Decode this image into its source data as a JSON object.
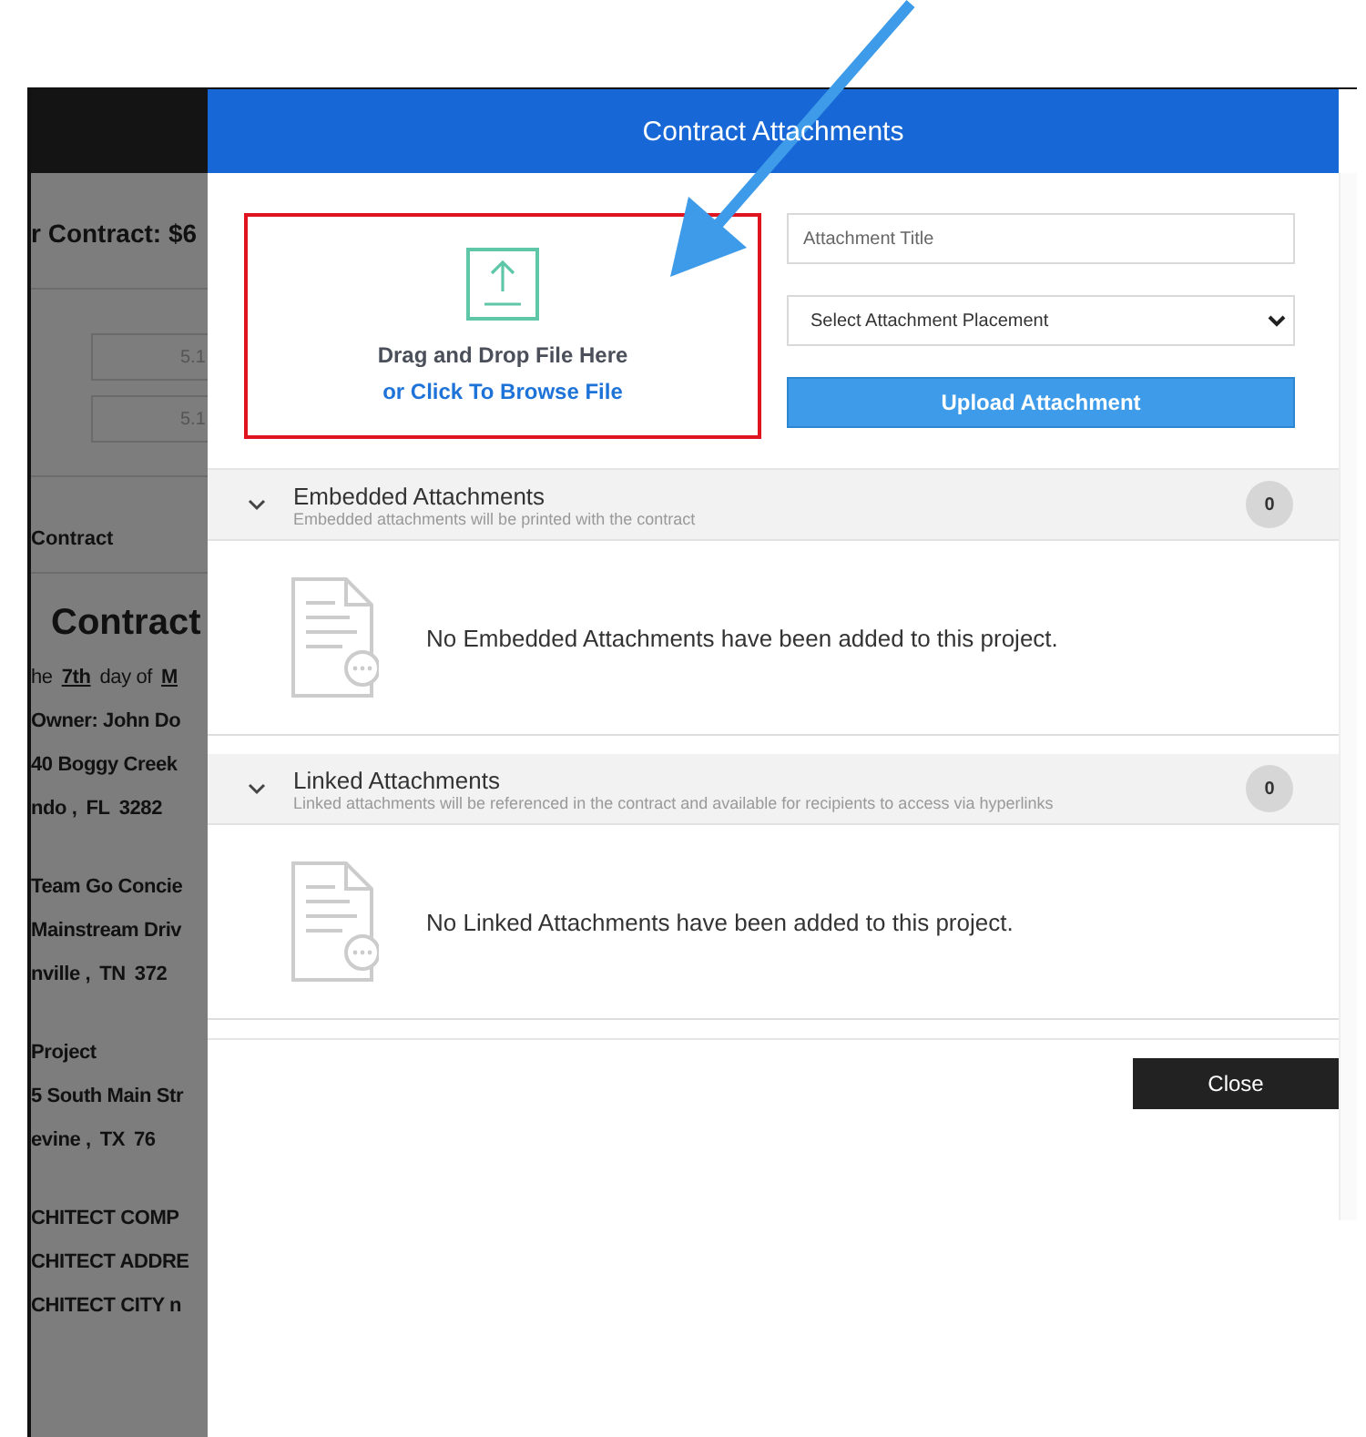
{
  "background_page": {
    "summary": "r Contract: $6",
    "fields": [
      "5.1",
      "5.1"
    ],
    "breadcrumb": "Contract",
    "heading": "Contract",
    "blocks": [
      [
        [
          {
            "text": "he",
            "underline": false
          },
          {
            "text": "7th",
            "underline": true
          },
          {
            "text": "day of",
            "underline": false
          },
          {
            "text": "M",
            "underline": true
          }
        ],
        [
          {
            "text": "Owner: John Do",
            "underline": false
          }
        ],
        [
          {
            "text": "40 Boggy Creek",
            "underline": false
          }
        ],
        [
          {
            "text": "ndo ,",
            "underline": false
          },
          {
            "text": "FL",
            "underline": false
          },
          {
            "text": "3282",
            "underline": false
          }
        ]
      ],
      [
        [
          {
            "text": "Team Go Concie",
            "underline": false
          }
        ],
        [
          {
            "text": "Mainstream Driv",
            "underline": false
          }
        ],
        [
          {
            "text": "nville ,",
            "underline": false
          },
          {
            "text": "TN",
            "underline": false
          },
          {
            "text": "372",
            "underline": false
          }
        ]
      ],
      [
        [
          {
            "text": "Project",
            "underline": false
          }
        ],
        [
          {
            "text": "5 South Main Str",
            "underline": false
          }
        ],
        [
          {
            "text": "evine ,",
            "underline": false
          },
          {
            "text": "TX",
            "underline": false
          },
          {
            "text": "76",
            "underline": false
          }
        ]
      ],
      [
        [
          {
            "text": "CHITECT COMP",
            "underline": false
          }
        ],
        [
          {
            "text": "CHITECT ADDRE",
            "underline": false
          }
        ],
        [
          {
            "text": "CHITECT CITY n",
            "underline": false
          }
        ]
      ]
    ]
  },
  "modal": {
    "title": "Contract Attachments",
    "dropzone": {
      "highlighted": true,
      "line1": "Drag and Drop File Here",
      "line2": "or Click To Browse File"
    },
    "title_field": {
      "placeholder": "Attachment Title"
    },
    "placement_select": {
      "value": "Select Attachment Placement"
    },
    "upload_button": "Upload Attachment",
    "sections": [
      {
        "title": "Embedded Attachments",
        "subtitle": "Embedded attachments will be printed with the contract",
        "count": "0",
        "expanded": true,
        "empty_message": "No Embedded Attachments have been added to this project."
      },
      {
        "title": "Linked Attachments",
        "subtitle": "Linked attachments will be referenced in the contract and available for recipients to access via hyperlinks",
        "count": "0",
        "expanded": true,
        "empty_message": "No Linked Attachments have been added to this project."
      }
    ],
    "close_button": "Close"
  }
}
